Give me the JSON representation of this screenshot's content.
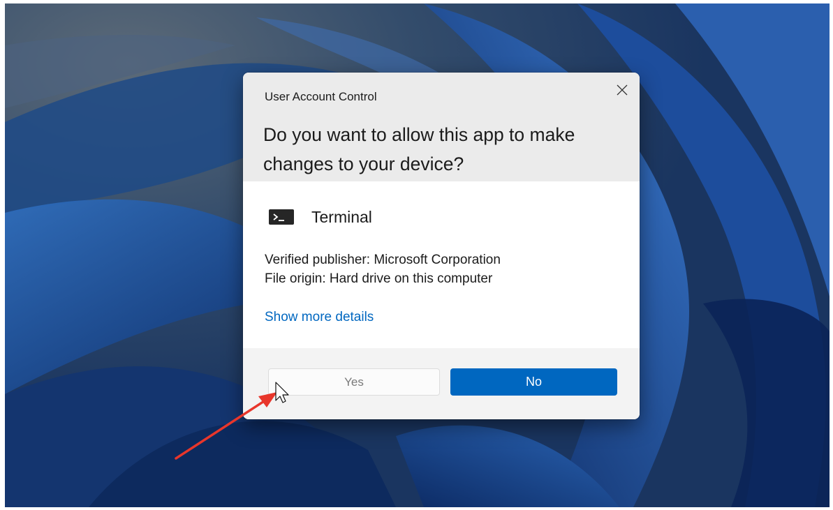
{
  "dialog": {
    "title": "User Account Control",
    "question": "Do you want to allow this app to make changes to your device?",
    "app_name": "Terminal",
    "app_icon": "terminal-icon",
    "publisher_line": "Verified publisher: Microsoft Corporation",
    "origin_line": "File origin: Hard drive on this computer",
    "details_link": "Show more details",
    "yes_label": "Yes",
    "no_label": "No",
    "close_icon": "close-icon"
  },
  "colors": {
    "accent": "#0067c0",
    "header_bg": "#ebebeb",
    "footer_bg": "#f3f3f3",
    "annotation_arrow": "#e8362b"
  }
}
